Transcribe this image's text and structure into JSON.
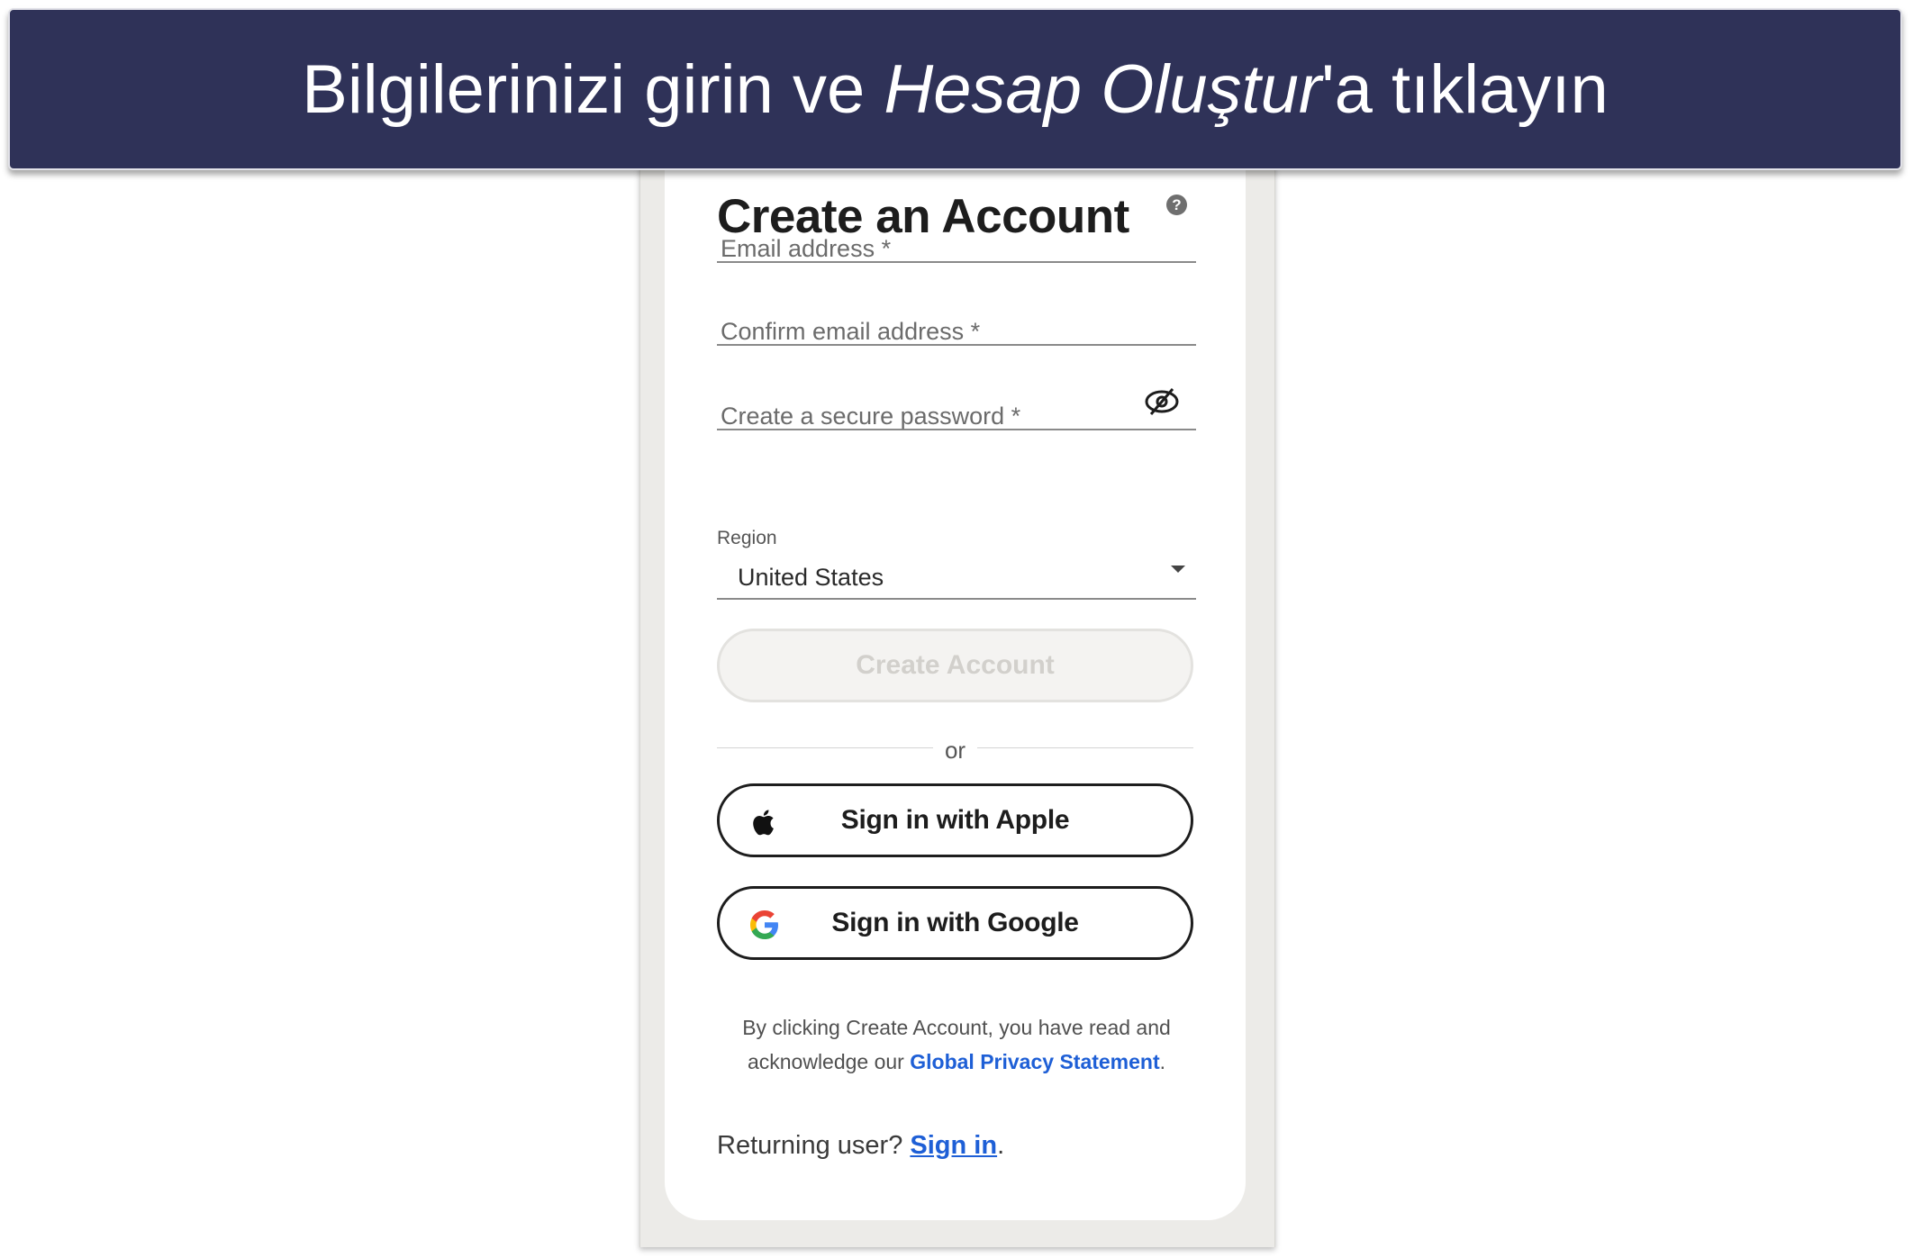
{
  "banner": {
    "text_before": "Bilgilerinizi girin ve ",
    "text_emphasis": "Hesap Oluştur",
    "text_after": "'a tıklayın"
  },
  "form": {
    "title": "Create an Account",
    "email": {
      "placeholder": "Email address *",
      "value": "",
      "help_icon": "question-circle-icon"
    },
    "confirm_email": {
      "placeholder": "Confirm email address *",
      "value": ""
    },
    "password": {
      "placeholder": "Create a secure password *",
      "value": "",
      "visibility_icon": "eye-slash-icon"
    },
    "region": {
      "label": "Region",
      "selected": "United States"
    },
    "create_button": "Create Account",
    "divider_text": "or",
    "apple_button": "Sign in with Apple",
    "google_button": "Sign in with Google",
    "legal": {
      "text": "By clicking Create Account, you have read and acknowledge our ",
      "link": "Global Privacy Statement",
      "end": "."
    },
    "returning": {
      "text": "Returning user? ",
      "link": "Sign in",
      "end": "."
    }
  },
  "colors": {
    "banner_bg": "#2f3258",
    "link": "#1e5fd6",
    "disabled_button_text": "#d2d0cc"
  }
}
